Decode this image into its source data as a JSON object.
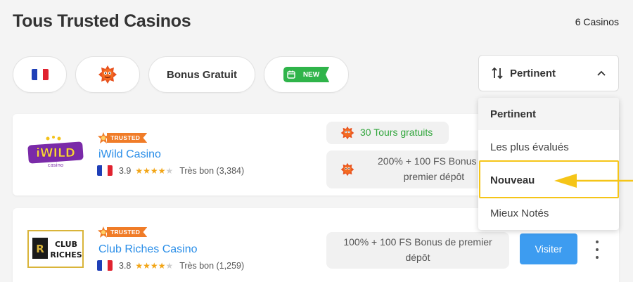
{
  "header": {
    "title": "Tous Trusted Casinos",
    "count": "6 Casinos"
  },
  "filters": {
    "bonus_label": "Bonus Gratuit",
    "new_label": "NEW"
  },
  "sort": {
    "selected": "Pertinent",
    "options": [
      "Pertinent",
      "Les plus évalués",
      "Nouveau",
      "Mieux Notés"
    ]
  },
  "trusted_label": "TRUSTED",
  "casinos": [
    {
      "name": "iWild Casino",
      "rating": "3.9",
      "stars": 4,
      "rating_text": "Très bon (3,384)",
      "free_spins": "30 Tours gratuits",
      "bonus": "200% + 100 FS Bonus de premier dépôt"
    },
    {
      "name": "Club Riches Casino",
      "rating": "3.8",
      "stars": 4,
      "rating_text": "Très bon (1,259)",
      "bonus": "100% + 100 FS Bonus de premier dépôt",
      "visit_label": "Visiter"
    }
  ],
  "colors": {
    "accent": "#3d9cf0",
    "highlight": "#f5c518",
    "trusted": "#f07c28",
    "new": "#2fb44a"
  }
}
